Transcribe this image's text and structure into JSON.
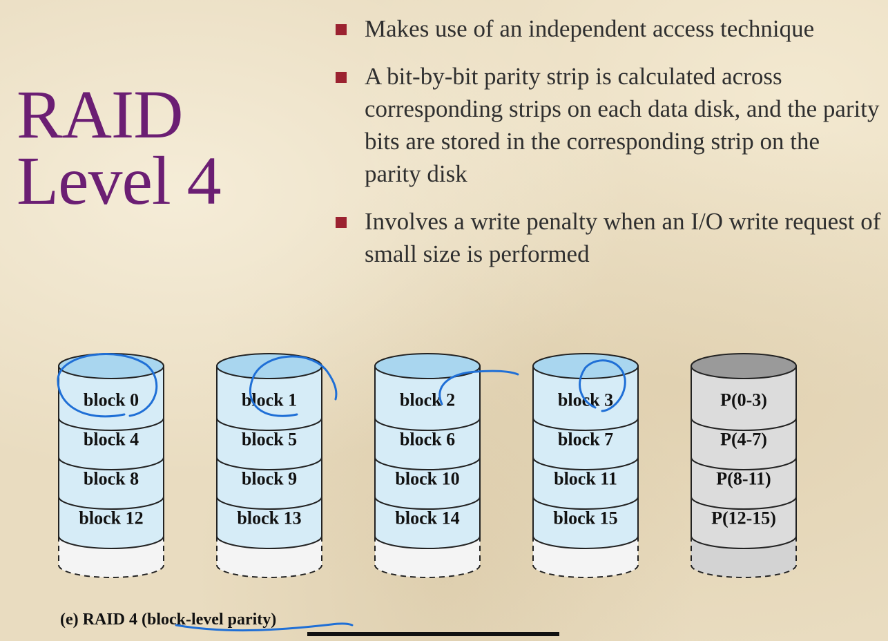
{
  "title": {
    "line1": "RAID",
    "line2": "Level 4"
  },
  "bullets": [
    {
      "text": "Makes use of an independent access technique"
    },
    {
      "text": "A bit-by-bit parity strip is calculated across corresponding strips on each data disk, and the parity bits are stored in the corresponding strip on the parity disk"
    },
    {
      "text": "Involves a write penalty when an I/O write request of small size is performed"
    }
  ],
  "disks": [
    {
      "type": "data",
      "blocks": [
        "block 0",
        "block 4",
        "block 8",
        "block 12"
      ]
    },
    {
      "type": "data",
      "blocks": [
        "block 1",
        "block 5",
        "block 9",
        "block 13"
      ]
    },
    {
      "type": "data",
      "blocks": [
        "block 2",
        "block 6",
        "block 10",
        "block 14"
      ]
    },
    {
      "type": "data",
      "blocks": [
        "block 3",
        "block 7",
        "block 11",
        "block 15"
      ]
    },
    {
      "type": "parity",
      "blocks": [
        "P(0-3)",
        "P(4-7)",
        "P(8-11)",
        "P(12-15)"
      ]
    }
  ],
  "caption": "(e) RAID 4 (block-level parity)",
  "colors": {
    "title": "#6b1e73",
    "bullet_marker": "#9b2230",
    "data_disk_fill": "#d6ecf7",
    "data_disk_top": "#a9d6ef",
    "parity_disk_fill": "#dcdcdc",
    "parity_disk_top": "#9a9a9a",
    "annotation": "#1f6fd6"
  }
}
